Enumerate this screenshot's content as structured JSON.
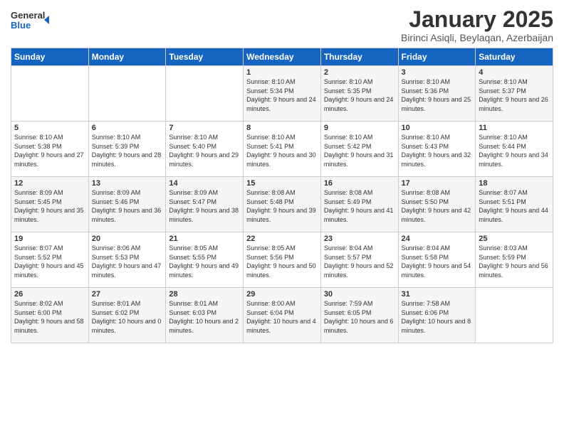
{
  "logo": {
    "line1": "General",
    "line2": "Blue"
  },
  "title": "January 2025",
  "subtitle": "Birinci Asiqli, Beylaqan, Azerbaijan",
  "headers": [
    "Sunday",
    "Monday",
    "Tuesday",
    "Wednesday",
    "Thursday",
    "Friday",
    "Saturday"
  ],
  "weeks": [
    [
      {
        "day": "",
        "info": ""
      },
      {
        "day": "",
        "info": ""
      },
      {
        "day": "",
        "info": ""
      },
      {
        "day": "1",
        "info": "Sunrise: 8:10 AM\nSunset: 5:34 PM\nDaylight: 9 hours\nand 24 minutes."
      },
      {
        "day": "2",
        "info": "Sunrise: 8:10 AM\nSunset: 5:35 PM\nDaylight: 9 hours\nand 24 minutes."
      },
      {
        "day": "3",
        "info": "Sunrise: 8:10 AM\nSunset: 5:36 PM\nDaylight: 9 hours\nand 25 minutes."
      },
      {
        "day": "4",
        "info": "Sunrise: 8:10 AM\nSunset: 5:37 PM\nDaylight: 9 hours\nand 26 minutes."
      }
    ],
    [
      {
        "day": "5",
        "info": "Sunrise: 8:10 AM\nSunset: 5:38 PM\nDaylight: 9 hours\nand 27 minutes."
      },
      {
        "day": "6",
        "info": "Sunrise: 8:10 AM\nSunset: 5:39 PM\nDaylight: 9 hours\nand 28 minutes."
      },
      {
        "day": "7",
        "info": "Sunrise: 8:10 AM\nSunset: 5:40 PM\nDaylight: 9 hours\nand 29 minutes."
      },
      {
        "day": "8",
        "info": "Sunrise: 8:10 AM\nSunset: 5:41 PM\nDaylight: 9 hours\nand 30 minutes."
      },
      {
        "day": "9",
        "info": "Sunrise: 8:10 AM\nSunset: 5:42 PM\nDaylight: 9 hours\nand 31 minutes."
      },
      {
        "day": "10",
        "info": "Sunrise: 8:10 AM\nSunset: 5:43 PM\nDaylight: 9 hours\nand 32 minutes."
      },
      {
        "day": "11",
        "info": "Sunrise: 8:10 AM\nSunset: 5:44 PM\nDaylight: 9 hours\nand 34 minutes."
      }
    ],
    [
      {
        "day": "12",
        "info": "Sunrise: 8:09 AM\nSunset: 5:45 PM\nDaylight: 9 hours\nand 35 minutes."
      },
      {
        "day": "13",
        "info": "Sunrise: 8:09 AM\nSunset: 5:46 PM\nDaylight: 9 hours\nand 36 minutes."
      },
      {
        "day": "14",
        "info": "Sunrise: 8:09 AM\nSunset: 5:47 PM\nDaylight: 9 hours\nand 38 minutes."
      },
      {
        "day": "15",
        "info": "Sunrise: 8:08 AM\nSunset: 5:48 PM\nDaylight: 9 hours\nand 39 minutes."
      },
      {
        "day": "16",
        "info": "Sunrise: 8:08 AM\nSunset: 5:49 PM\nDaylight: 9 hours\nand 41 minutes."
      },
      {
        "day": "17",
        "info": "Sunrise: 8:08 AM\nSunset: 5:50 PM\nDaylight: 9 hours\nand 42 minutes."
      },
      {
        "day": "18",
        "info": "Sunrise: 8:07 AM\nSunset: 5:51 PM\nDaylight: 9 hours\nand 44 minutes."
      }
    ],
    [
      {
        "day": "19",
        "info": "Sunrise: 8:07 AM\nSunset: 5:52 PM\nDaylight: 9 hours\nand 45 minutes."
      },
      {
        "day": "20",
        "info": "Sunrise: 8:06 AM\nSunset: 5:53 PM\nDaylight: 9 hours\nand 47 minutes."
      },
      {
        "day": "21",
        "info": "Sunrise: 8:05 AM\nSunset: 5:55 PM\nDaylight: 9 hours\nand 49 minutes."
      },
      {
        "day": "22",
        "info": "Sunrise: 8:05 AM\nSunset: 5:56 PM\nDaylight: 9 hours\nand 50 minutes."
      },
      {
        "day": "23",
        "info": "Sunrise: 8:04 AM\nSunset: 5:57 PM\nDaylight: 9 hours\nand 52 minutes."
      },
      {
        "day": "24",
        "info": "Sunrise: 8:04 AM\nSunset: 5:58 PM\nDaylight: 9 hours\nand 54 minutes."
      },
      {
        "day": "25",
        "info": "Sunrise: 8:03 AM\nSunset: 5:59 PM\nDaylight: 9 hours\nand 56 minutes."
      }
    ],
    [
      {
        "day": "26",
        "info": "Sunrise: 8:02 AM\nSunset: 6:00 PM\nDaylight: 9 hours\nand 58 minutes."
      },
      {
        "day": "27",
        "info": "Sunrise: 8:01 AM\nSunset: 6:02 PM\nDaylight: 10 hours\nand 0 minutes."
      },
      {
        "day": "28",
        "info": "Sunrise: 8:01 AM\nSunset: 6:03 PM\nDaylight: 10 hours\nand 2 minutes."
      },
      {
        "day": "29",
        "info": "Sunrise: 8:00 AM\nSunset: 6:04 PM\nDaylight: 10 hours\nand 4 minutes."
      },
      {
        "day": "30",
        "info": "Sunrise: 7:59 AM\nSunset: 6:05 PM\nDaylight: 10 hours\nand 6 minutes."
      },
      {
        "day": "31",
        "info": "Sunrise: 7:58 AM\nSunset: 6:06 PM\nDaylight: 10 hours\nand 8 minutes."
      },
      {
        "day": "",
        "info": ""
      }
    ]
  ]
}
